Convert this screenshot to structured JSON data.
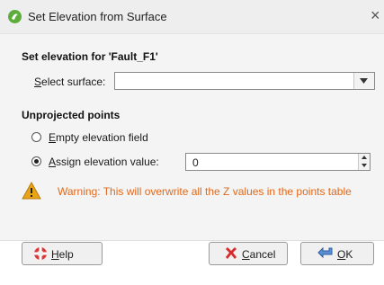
{
  "window": {
    "title": "Set Elevation from Surface",
    "close_glyph": "×"
  },
  "section_elevation": {
    "heading": "Set elevation for 'Fault_F1'",
    "select_surface_mnemonic": "S",
    "select_surface_rest": "elect surface:",
    "select_surface_value": ""
  },
  "section_unprojected": {
    "heading": "Unprojected points",
    "option_empty": {
      "mnemonic": "E",
      "rest": "mpty elevation field",
      "selected": false
    },
    "option_assign": {
      "mnemonic": "A",
      "rest": "ssign elevation value:",
      "selected": true
    },
    "assign_value": "0"
  },
  "warning": {
    "text": "Warning: This will overwrite all the Z values in the points table"
  },
  "buttons": {
    "help": {
      "mnemonic": "H",
      "rest": "elp"
    },
    "cancel": {
      "mnemonic": "C",
      "rest": "ancel"
    },
    "ok": {
      "mnemonic": "O",
      "rest": "K"
    }
  },
  "colors": {
    "warning_text": "#e0691b",
    "warning_icon": "#e8a317",
    "app_icon": "#5dad3c"
  },
  "icons": [
    "app-logo-icon",
    "close-icon",
    "dropdown-arrow-icon",
    "spin-up-icon",
    "spin-down-icon",
    "warning-icon",
    "help-lifebuoy-icon",
    "cancel-x-icon",
    "ok-arrow-icon"
  ]
}
